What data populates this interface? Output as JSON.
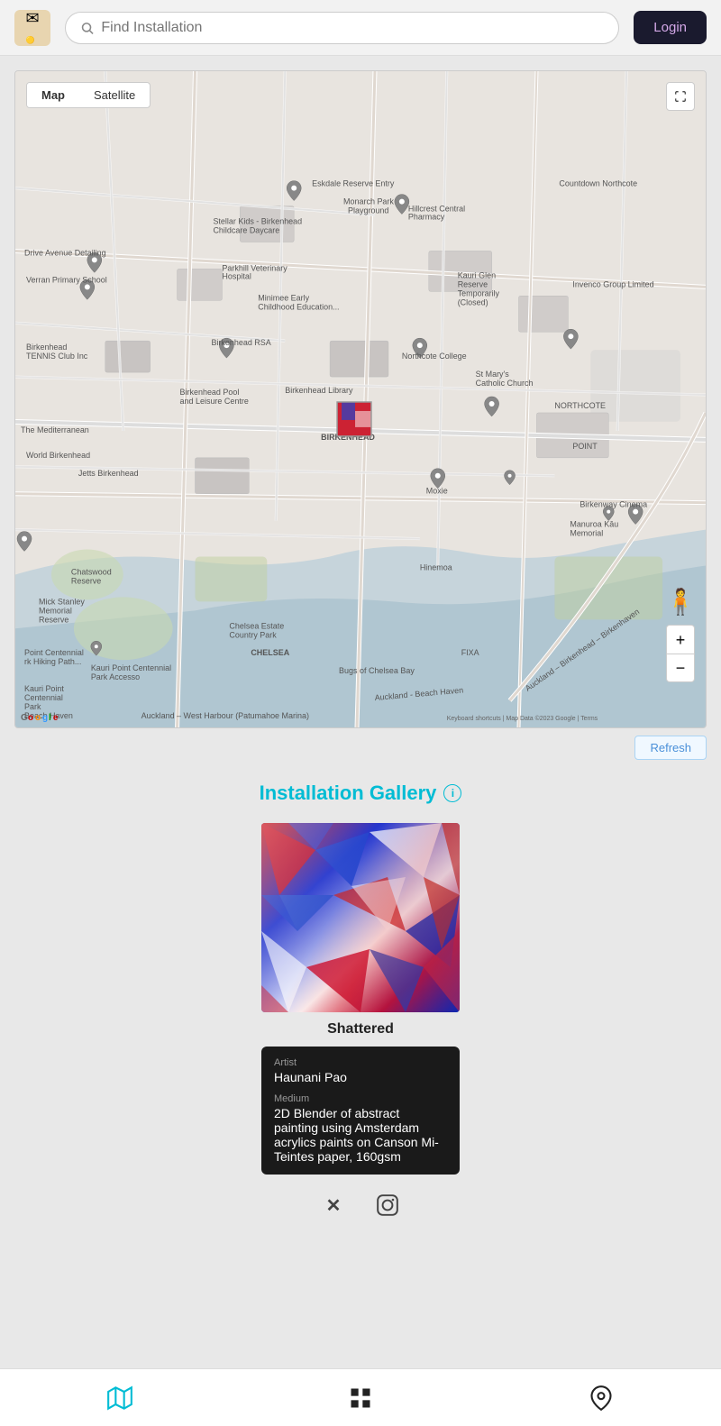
{
  "header": {
    "logo_char": "✉",
    "search_placeholder": "Find Installation",
    "login_label": "Login"
  },
  "map": {
    "toggle_map": "Map",
    "toggle_satellite": "Satellite",
    "marker_label": "Birkenhead Library",
    "attribution_center": "Auckland - Beach Haven\nAuckland – West Harbour (Patumahoe Marina)",
    "attribution_right": "Keyboard shortcuts | Map Data ©2023 Google | Terms",
    "zoom_in": "+",
    "zoom_out": "−",
    "pegman": "🧍"
  },
  "refresh": {
    "label": "Refresh"
  },
  "gallery": {
    "title": "Installation Gallery",
    "info_icon": "i",
    "artwork": {
      "title": "Shattered",
      "artist_label": "Artist",
      "artist_value": "Haunani Pao",
      "medium_label": "Medium",
      "medium_value": "2D Blender of abstract painting using Amsterdam acrylics paints on Canson Mi-Teintes paper, 160gsm"
    }
  },
  "social": {
    "x_label": "X",
    "instagram_label": "Instagram"
  },
  "bottom_nav": {
    "map_label": "Map",
    "grid_label": "Grid",
    "pin_label": "Pin"
  }
}
